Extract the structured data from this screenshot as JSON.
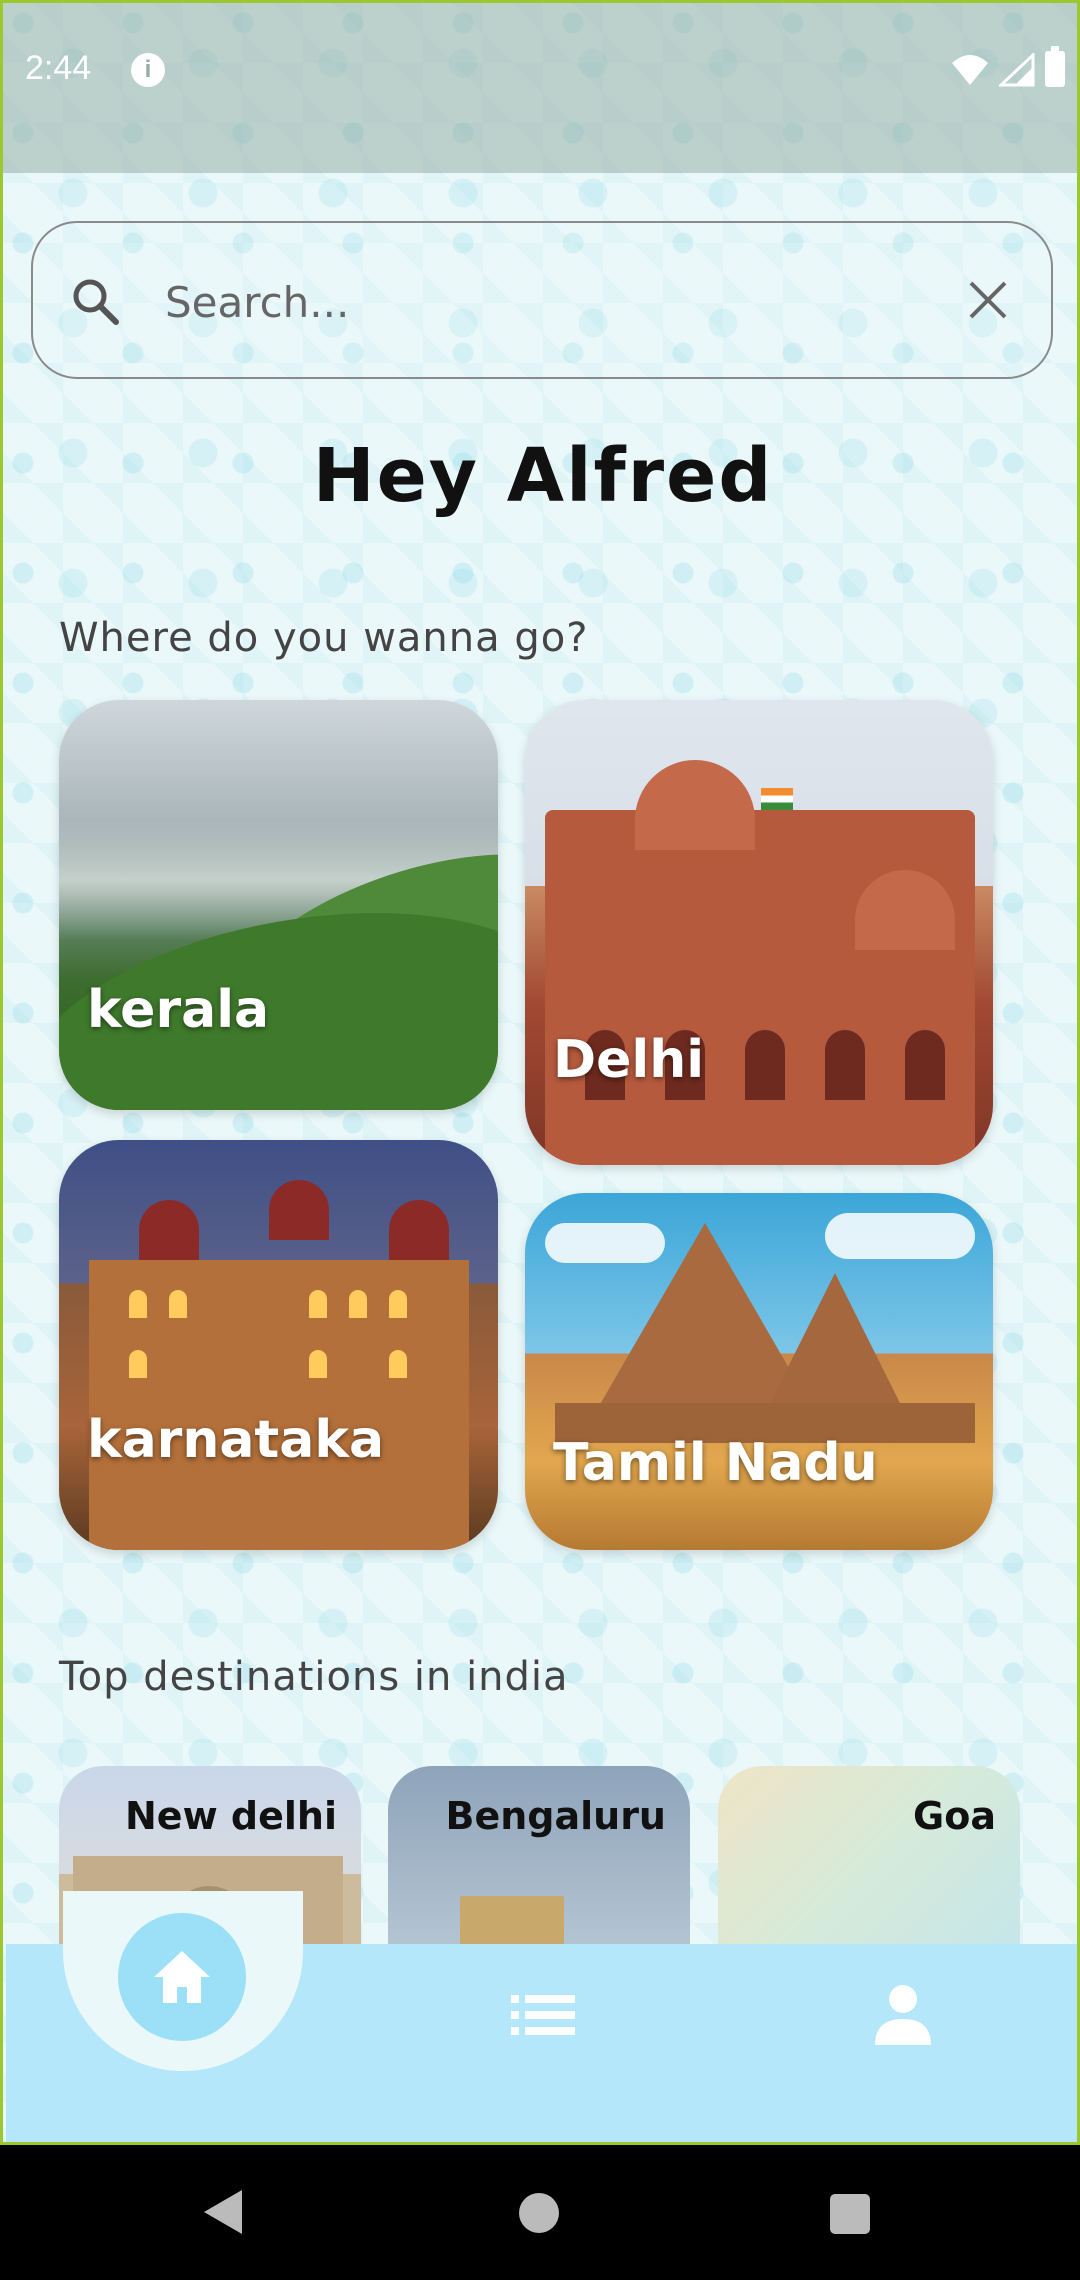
{
  "status_bar": {
    "time": "2:44"
  },
  "search": {
    "placeholder": "Search..."
  },
  "greeting": "Hey  Alfred",
  "sections": {
    "where_title": "Where do you wanna go?",
    "top_title": "Top destinations in india"
  },
  "states": [
    {
      "name": "kerala"
    },
    {
      "name": "Delhi"
    },
    {
      "name": "karnataka"
    },
    {
      "name": "Tamil  Nadu"
    }
  ],
  "top_destinations": [
    {
      "name": "New  delhi"
    },
    {
      "name": "Bengaluru"
    },
    {
      "name": "Goa"
    }
  ],
  "nav": {
    "items": [
      "home-icon",
      "list-icon",
      "person-icon"
    ],
    "active": "home",
    "bar_color": "#b3e7f9"
  }
}
